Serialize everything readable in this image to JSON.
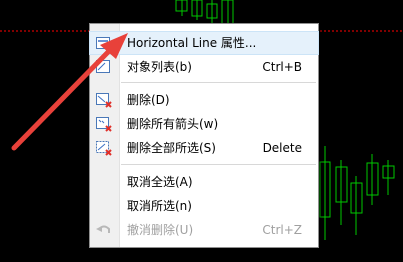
{
  "menu": {
    "items": [
      {
        "label": "Horizontal Line 属性...",
        "shortcut": "",
        "icon": "line-properties-icon",
        "enabled": true
      },
      {
        "label": "对象列表(b)",
        "shortcut": "Ctrl+B",
        "icon": "object-list-icon",
        "enabled": true
      },
      {
        "label": "删除(D)",
        "shortcut": "",
        "icon": "delete-icon",
        "enabled": true
      },
      {
        "label": "删除所有箭头(w)",
        "shortcut": "",
        "icon": "delete-arrows-icon",
        "enabled": true
      },
      {
        "label": "删除全部所选(S)",
        "shortcut": "Delete",
        "icon": "delete-selected-icon",
        "enabled": true
      },
      {
        "label": "取消全选(A)",
        "shortcut": "",
        "icon": "",
        "enabled": true
      },
      {
        "label": "取消所选(n)",
        "shortcut": "",
        "icon": "",
        "enabled": true
      },
      {
        "label": "撤消删除(U)",
        "shortcut": "Ctrl+Z",
        "icon": "undo-icon",
        "enabled": false
      }
    ]
  },
  "colors": {
    "chart_background": "#000000",
    "candle_up": "#00c800",
    "horizontal_line": "#ff0000",
    "annotation_arrow": "#e8413a"
  }
}
